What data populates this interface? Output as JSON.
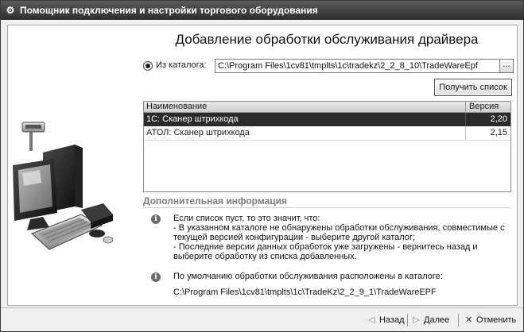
{
  "window": {
    "title": "Помощник подключения и настройки торгового оборудования"
  },
  "page": {
    "heading": "Добавление обработки обслуживания драйвера"
  },
  "source": {
    "radio_label": "Из каталога:",
    "path_value": "C:\\Program Files\\1cv81\\tmplts\\1c\\tradekz\\2_2_8_10\\TradeWareEpf",
    "browse_label": "...",
    "get_list_label": "Получить список"
  },
  "table": {
    "columns": [
      "Наименование",
      "Версия"
    ],
    "rows": [
      {
        "name": "1С: Сканер штрихкода",
        "version": "2,20",
        "selected": true
      },
      {
        "name": "АТОЛ: Сканер штрихкода",
        "version": "2,15",
        "selected": false
      }
    ]
  },
  "additional_info": {
    "title": "Дополнительная информация",
    "block1": [
      "Если список пуст, то это значит, что:",
      "- В указанном каталоге не обнаружены обработки обслуживания, совместимые с",
      "текущей версией конфигурации - выберите другой каталог;",
      "- Последние версии данных обработок уже загружены - вернитесь назад и",
      "выберите обработку из списка добавленных."
    ],
    "block2_line1": "По умолчанию обработки обслуживания расположены в каталоге:",
    "block2_path": "C:\\Program Files\\1cv81\\tmplts\\1c\\TradeKz\\2_2_9_1\\TradeWareEPF"
  },
  "footer": {
    "back_label": "Назад",
    "next_label": "Далее",
    "cancel_label": "Отменить"
  }
}
